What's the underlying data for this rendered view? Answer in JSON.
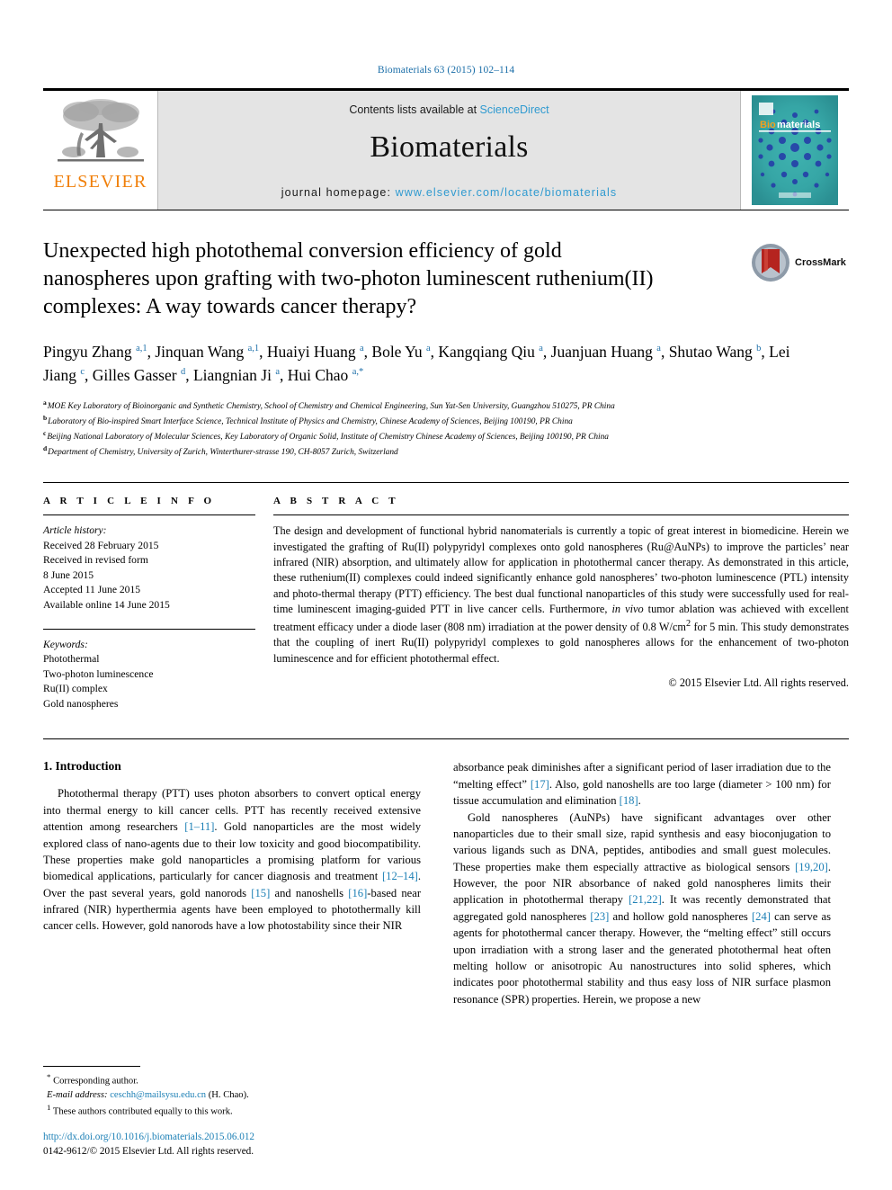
{
  "running_head": "Biomaterials 63 (2015) 102–114",
  "masthead": {
    "publisher_name": "ELSEVIER",
    "contents_prefix": "Contents lists available at ",
    "contents_link": "ScienceDirect",
    "journal_name": "Biomaterials",
    "homepage_prefix": "journal homepage: ",
    "homepage_url": "www.elsevier.com/locate/biomaterials",
    "cover_title_bio": "Bio",
    "cover_title_materials": "materials"
  },
  "article": {
    "title": "Unexpected high photothemal conversion efficiency of gold nanospheres upon grafting with two-photon luminescent ruthenium(II) complexes: A way towards cancer therapy?",
    "crossmark_label": "CrossMark"
  },
  "authors_html": "Pingyu Zhang <sup>a,1</sup>, Jinquan Wang <sup>a,1</sup>, Huaiyi Huang <sup>a</sup>, Bole Yu <sup>a</sup>, Kangqiang Qiu <sup>a</sup>, Juanjuan Huang <sup>a</sup>, Shutao Wang <sup>b</sup>, Lei Jiang <sup>c</sup>, Gilles Gasser <sup>d</sup>, Liangnian Ji <sup>a</sup>, Hui Chao <sup>a,*</sup>",
  "affiliations": [
    {
      "mark": "a",
      "text": "MOE Key Laboratory of Bioinorganic and Synthetic Chemistry, School of Chemistry and Chemical Engineering, Sun Yat-Sen University, Guangzhou 510275, PR China"
    },
    {
      "mark": "b",
      "text": "Laboratory of Bio-inspired Smart Interface Science, Technical Institute of Physics and Chemistry, Chinese Academy of Sciences, Beijing 100190, PR China"
    },
    {
      "mark": "c",
      "text": "Beijing National Laboratory of Molecular Sciences, Key Laboratory of Organic Solid, Institute of Chemistry Chinese Academy of Sciences, Beijing 100190, PR China"
    },
    {
      "mark": "d",
      "text": "Department of Chemistry, University of Zurich, Winterthurer-strasse 190, CH-8057 Zurich, Switzerland"
    }
  ],
  "article_info": {
    "heading": "A R T I C L E   I N F O",
    "history_label": "Article history:",
    "history": [
      "Received 28 February 2015",
      "Received in revised form",
      "8 June 2015",
      "Accepted 11 June 2015",
      "Available online 14 June 2015"
    ],
    "keywords_label": "Keywords:",
    "keywords": [
      "Photothermal",
      "Two-photon luminescence",
      "Ru(II) complex",
      "Gold nanospheres"
    ]
  },
  "abstract": {
    "heading": "A B S T R A C T",
    "paragraph_html": "The design and development of functional hybrid nanomaterials is currently a topic of great interest in biomedicine. Herein we investigated the grafting of Ru(II) polypyridyl complexes onto gold nanospheres (Ru@AuNPs) to improve the particles&rsquo; near infrared (NIR) absorption, and ultimately allow for application in photothermal cancer therapy. As demonstrated in this article, these ruthenium(II) complexes could indeed significantly enhance gold nanospheres&rsquo; two-photon luminescence (PTL) intensity and photo-thermal therapy (PTT) efficiency. The best dual functional nanoparticles of this study were successfully used for real-time luminescent imaging-guided PTT in live cancer cells. Furthermore, <span class=\"ital\">in vivo</span> tumor ablation was achieved with excellent treatment efficacy under a diode laser (808 nm) irradiation at the power density of 0.8 W/cm<sup>2</sup> for 5 min. This study demonstrates that the coupling of inert Ru(II) polypyridyl complexes to gold nanospheres allows for the enhancement of two-photon luminescence and for efficient photothermal effect.",
    "copyright": "© 2015 Elsevier Ltd. All rights reserved."
  },
  "introduction": {
    "section_number_title": "1. Introduction",
    "left_paragraph_html": "Photothermal therapy (PTT) uses photon absorbers to convert optical energy into thermal energy to kill cancer cells. PTT has recently received extensive attention among researchers <span class=\"ref\">[1&ndash;11]</span>. Gold nanoparticles are the most widely explored class of nano-agents due to their low toxicity and good biocompatibility. These properties make gold nanoparticles a promising platform for various biomedical applications, particularly for cancer diagnosis and treatment <span class=\"ref\">[12&ndash;14]</span>. Over the past several years, gold nanorods <span class=\"ref\">[15]</span> and nanoshells <span class=\"ref\">[16]</span>-based near infrared (NIR) hyperthermia agents have been employed to photothermally kill cancer cells. However, gold nanorods have a low photostability since their NIR",
    "right_paragraph_1_html": "absorbance peak diminishes after a significant period of laser irradiation due to the &ldquo;melting effect&rdquo; <span class=\"ref\">[17]</span>. Also, gold nanoshells are too large (diameter &gt; 100 nm) for tissue accumulation and elimination <span class=\"ref\">[18]</span>.",
    "right_paragraph_2_html": "Gold nanospheres (AuNPs) have significant advantages over other nanoparticles due to their small size, rapid synthesis and easy bioconjugation to various ligands such as DNA, peptides, antibodies and small guest molecules. These properties make them especially attractive as biological sensors <span class=\"ref\">[19,20]</span>. However, the poor NIR absorbance of naked gold nanospheres limits their application in photothermal therapy <span class=\"ref\">[21,22]</span>. It was recently demonstrated that aggregated gold nanospheres <span class=\"ref\">[23]</span> and hollow gold nanospheres <span class=\"ref\">[24]</span> can serve as agents for photothermal cancer therapy. However, the &ldquo;melting effect&rdquo; still occurs upon irradiation with a strong laser and the generated photothermal heat often melting hollow or anisotropic Au nanostructures into solid spheres, which indicates poor photothermal stability and thus easy loss of NIR surface plasmon resonance (SPR) properties. Herein, we propose a new"
  },
  "footnotes": {
    "corresponding_html": "<sup>*</sup> Corresponding author.",
    "email_html": "<span class=\"ital\">E-mail address:</span> <span class=\"mail\">ceschh@mailsysu.edu.cn</span> (H. Chao).",
    "equal_html": "<sup>1</sup> These authors contributed equally to this work.",
    "doi": "http://dx.doi.org/10.1016/j.biomaterials.2015.06.012",
    "issn_line_html": "0142-9612/© 2015 Elsevier Ltd. All rights reserved."
  },
  "colors": {
    "link_blue": "#1b7fb5",
    "sciencedirect_blue": "#2f9ad0",
    "elsevier_orange": "#f07f09",
    "cover_teal": "#2e9a9c",
    "crossmark_red": "#b5241f"
  }
}
